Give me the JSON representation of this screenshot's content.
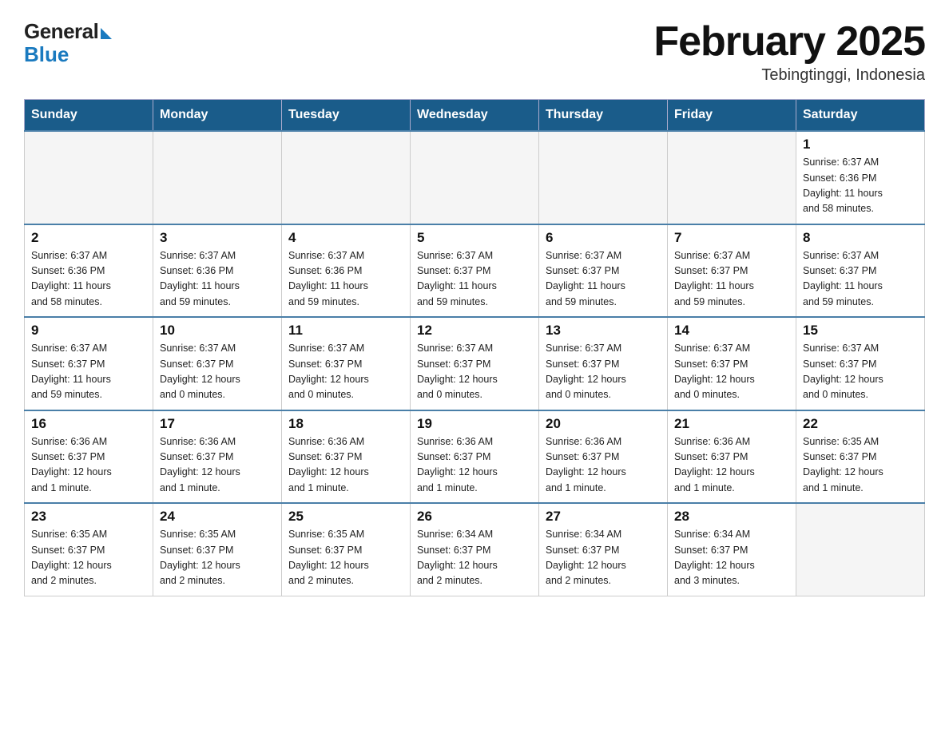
{
  "header": {
    "logo_general": "General",
    "logo_blue": "Blue",
    "main_title": "February 2025",
    "subtitle": "Tebingtinggi, Indonesia"
  },
  "calendar": {
    "weekdays": [
      "Sunday",
      "Monday",
      "Tuesday",
      "Wednesday",
      "Thursday",
      "Friday",
      "Saturday"
    ],
    "rows": [
      [
        {
          "day": "",
          "info": "",
          "empty": true
        },
        {
          "day": "",
          "info": "",
          "empty": true
        },
        {
          "day": "",
          "info": "",
          "empty": true
        },
        {
          "day": "",
          "info": "",
          "empty": true
        },
        {
          "day": "",
          "info": "",
          "empty": true
        },
        {
          "day": "",
          "info": "",
          "empty": true
        },
        {
          "day": "1",
          "info": "Sunrise: 6:37 AM\nSunset: 6:36 PM\nDaylight: 11 hours\nand 58 minutes.",
          "empty": false
        }
      ],
      [
        {
          "day": "2",
          "info": "Sunrise: 6:37 AM\nSunset: 6:36 PM\nDaylight: 11 hours\nand 58 minutes.",
          "empty": false
        },
        {
          "day": "3",
          "info": "Sunrise: 6:37 AM\nSunset: 6:36 PM\nDaylight: 11 hours\nand 59 minutes.",
          "empty": false
        },
        {
          "day": "4",
          "info": "Sunrise: 6:37 AM\nSunset: 6:36 PM\nDaylight: 11 hours\nand 59 minutes.",
          "empty": false
        },
        {
          "day": "5",
          "info": "Sunrise: 6:37 AM\nSunset: 6:37 PM\nDaylight: 11 hours\nand 59 minutes.",
          "empty": false
        },
        {
          "day": "6",
          "info": "Sunrise: 6:37 AM\nSunset: 6:37 PM\nDaylight: 11 hours\nand 59 minutes.",
          "empty": false
        },
        {
          "day": "7",
          "info": "Sunrise: 6:37 AM\nSunset: 6:37 PM\nDaylight: 11 hours\nand 59 minutes.",
          "empty": false
        },
        {
          "day": "8",
          "info": "Sunrise: 6:37 AM\nSunset: 6:37 PM\nDaylight: 11 hours\nand 59 minutes.",
          "empty": false
        }
      ],
      [
        {
          "day": "9",
          "info": "Sunrise: 6:37 AM\nSunset: 6:37 PM\nDaylight: 11 hours\nand 59 minutes.",
          "empty": false
        },
        {
          "day": "10",
          "info": "Sunrise: 6:37 AM\nSunset: 6:37 PM\nDaylight: 12 hours\nand 0 minutes.",
          "empty": false
        },
        {
          "day": "11",
          "info": "Sunrise: 6:37 AM\nSunset: 6:37 PM\nDaylight: 12 hours\nand 0 minutes.",
          "empty": false
        },
        {
          "day": "12",
          "info": "Sunrise: 6:37 AM\nSunset: 6:37 PM\nDaylight: 12 hours\nand 0 minutes.",
          "empty": false
        },
        {
          "day": "13",
          "info": "Sunrise: 6:37 AM\nSunset: 6:37 PM\nDaylight: 12 hours\nand 0 minutes.",
          "empty": false
        },
        {
          "day": "14",
          "info": "Sunrise: 6:37 AM\nSunset: 6:37 PM\nDaylight: 12 hours\nand 0 minutes.",
          "empty": false
        },
        {
          "day": "15",
          "info": "Sunrise: 6:37 AM\nSunset: 6:37 PM\nDaylight: 12 hours\nand 0 minutes.",
          "empty": false
        }
      ],
      [
        {
          "day": "16",
          "info": "Sunrise: 6:36 AM\nSunset: 6:37 PM\nDaylight: 12 hours\nand 1 minute.",
          "empty": false
        },
        {
          "day": "17",
          "info": "Sunrise: 6:36 AM\nSunset: 6:37 PM\nDaylight: 12 hours\nand 1 minute.",
          "empty": false
        },
        {
          "day": "18",
          "info": "Sunrise: 6:36 AM\nSunset: 6:37 PM\nDaylight: 12 hours\nand 1 minute.",
          "empty": false
        },
        {
          "day": "19",
          "info": "Sunrise: 6:36 AM\nSunset: 6:37 PM\nDaylight: 12 hours\nand 1 minute.",
          "empty": false
        },
        {
          "day": "20",
          "info": "Sunrise: 6:36 AM\nSunset: 6:37 PM\nDaylight: 12 hours\nand 1 minute.",
          "empty": false
        },
        {
          "day": "21",
          "info": "Sunrise: 6:36 AM\nSunset: 6:37 PM\nDaylight: 12 hours\nand 1 minute.",
          "empty": false
        },
        {
          "day": "22",
          "info": "Sunrise: 6:35 AM\nSunset: 6:37 PM\nDaylight: 12 hours\nand 1 minute.",
          "empty": false
        }
      ],
      [
        {
          "day": "23",
          "info": "Sunrise: 6:35 AM\nSunset: 6:37 PM\nDaylight: 12 hours\nand 2 minutes.",
          "empty": false
        },
        {
          "day": "24",
          "info": "Sunrise: 6:35 AM\nSunset: 6:37 PM\nDaylight: 12 hours\nand 2 minutes.",
          "empty": false
        },
        {
          "day": "25",
          "info": "Sunrise: 6:35 AM\nSunset: 6:37 PM\nDaylight: 12 hours\nand 2 minutes.",
          "empty": false
        },
        {
          "day": "26",
          "info": "Sunrise: 6:34 AM\nSunset: 6:37 PM\nDaylight: 12 hours\nand 2 minutes.",
          "empty": false
        },
        {
          "day": "27",
          "info": "Sunrise: 6:34 AM\nSunset: 6:37 PM\nDaylight: 12 hours\nand 2 minutes.",
          "empty": false
        },
        {
          "day": "28",
          "info": "Sunrise: 6:34 AM\nSunset: 6:37 PM\nDaylight: 12 hours\nand 3 minutes.",
          "empty": false
        },
        {
          "day": "",
          "info": "",
          "empty": true
        }
      ]
    ]
  }
}
